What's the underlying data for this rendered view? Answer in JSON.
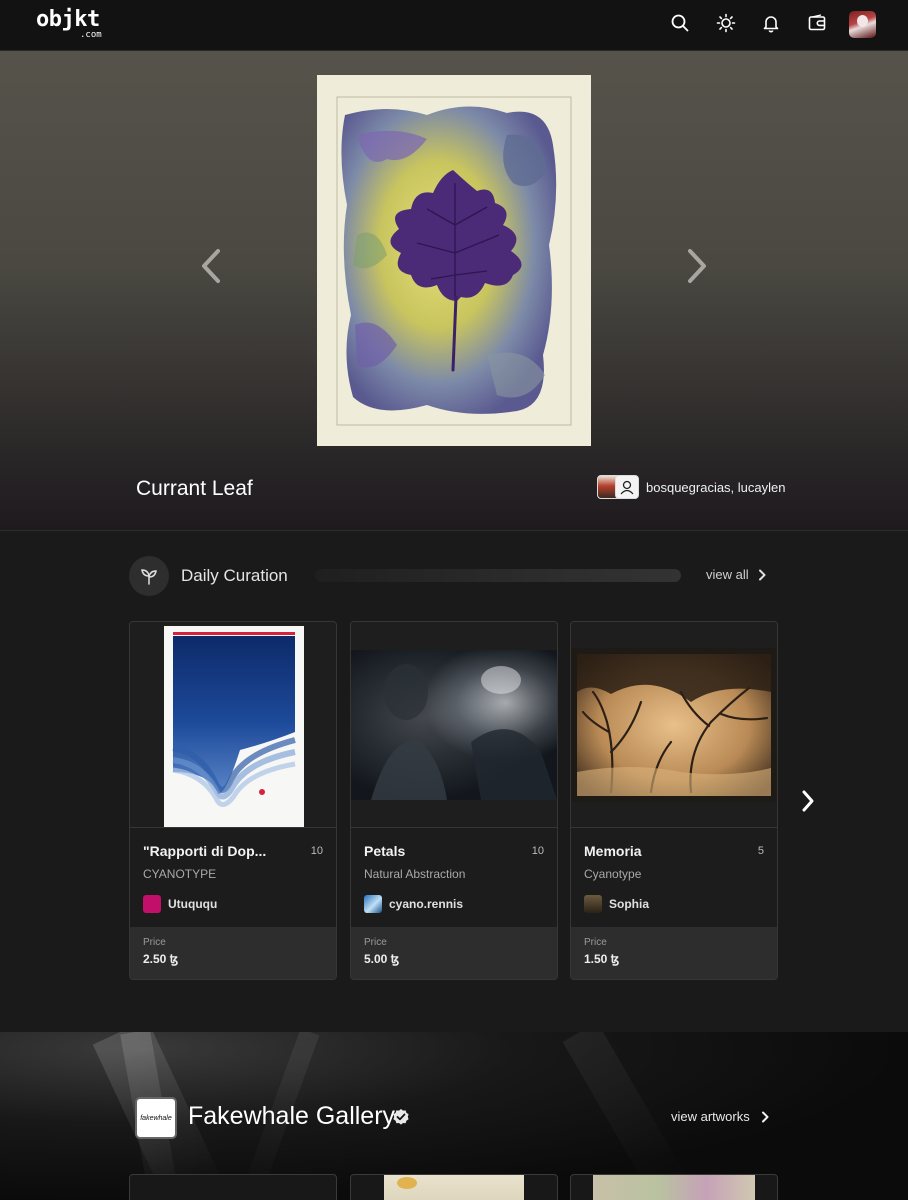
{
  "topbar": {
    "logo": "objkt",
    "logo_sub": ".com",
    "icons": [
      "search-icon",
      "sun-icon",
      "bell-icon",
      "wallet-icon"
    ],
    "avatar": "user-avatar"
  },
  "hero": {
    "title": "Currant Leaf",
    "artists": "bosquegracias, lucaylen"
  },
  "curation": {
    "title": "Daily Curation",
    "view_all": "view all",
    "cards": [
      {
        "title": "\"Rapporti di Dop...",
        "editions": "10",
        "subtitle": "CYANOTYPE",
        "artist": "Utuququ",
        "price_label": "Price",
        "price": "2.50 ꜩ"
      },
      {
        "title": "Petals",
        "editions": "10",
        "subtitle": "Natural Abstraction",
        "artist": "cyano.rennis",
        "price_label": "Price",
        "price": "5.00 ꜩ"
      },
      {
        "title": "Memoria",
        "editions": "5",
        "subtitle": "Cyanotype",
        "artist": "Sophia",
        "price_label": "Price",
        "price": "1.50 ꜩ"
      }
    ]
  },
  "gallery": {
    "logo_text": "fakewhale",
    "name": "Fakewhale Gallery",
    "view_artworks": "view artworks"
  },
  "colors": {
    "background": "#1a1a1a",
    "topbar": "#121212",
    "card_border": "#363636",
    "price_box": "#2d2d2e"
  }
}
